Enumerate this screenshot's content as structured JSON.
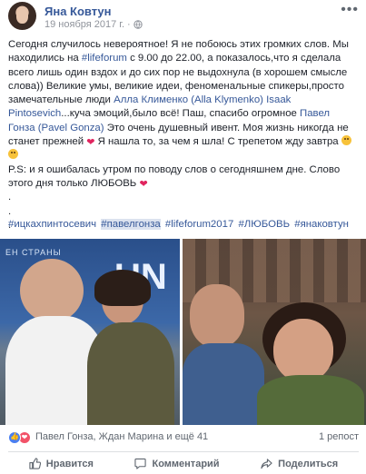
{
  "post": {
    "author": "Яна Ковтун",
    "date": "19 ноября 2017 г.",
    "date_sep": "·",
    "more_glyph": "•••",
    "paragraphs": [
      {
        "seg1": "Сегодня случилось невероятное! Я не побоюсь этих громких слов. Мы находились на ",
        "link1": "#lifeforum",
        "seg2": " с 9.00 до 22.00, а показалось,что я сделала всего лишь один вздох и до сих пор не выдохнула (в хорошем смысле слова)) Великие умы, великие идеи, феноменальные спикеры,просто замечательные люди ",
        "link2": "Алла Клименко (Alla Klymenko)",
        "seg3": " ",
        "link3": "Isaak Pintosevich",
        "seg4": "...куча эмоций,было всё! Паш, спасибо огромное ",
        "link4": "Павел Гонза (Pavel Gonza)",
        "seg5": " Это очень душевный ивент. Моя жизнь никогда не станет прежней ",
        "seg6": " Я нашла то, за чем я шла! С трепетом жду завтра ",
        "seg7": "P.S: и я ошибалась утром по поводу слов о сегодняшнем дне. Слово этого дня только ЛЮБОВЬ ",
        "dot1": ".",
        "dot2": ".",
        "dot3": "."
      }
    ],
    "heart_glyph": "❤",
    "hashtags": [
      "#ицкахпинтосевич",
      "#павелгонза",
      "#lifeforum2017",
      "#ЛЮБОВЬ",
      "#янаковтун"
    ],
    "photo_left_screen_text": "ЕН СТРАНЫ",
    "photo_left_big_text": "UN",
    "reactions_names": "Павел Гонза, Ждан Марина и ещё 41",
    "reposts": "1 репост",
    "actions": {
      "like": "Нравится",
      "comment": "Комментарий",
      "share": "Поделиться"
    }
  },
  "colors": {
    "link": "#365899",
    "secondary": "#606770",
    "hashtag_highlight": "#dbe2ef"
  },
  "icons": [
    "globe-icon",
    "more-icon",
    "like-reaction-icon",
    "love-reaction-icon",
    "like-icon",
    "comment-icon",
    "share-icon"
  ]
}
